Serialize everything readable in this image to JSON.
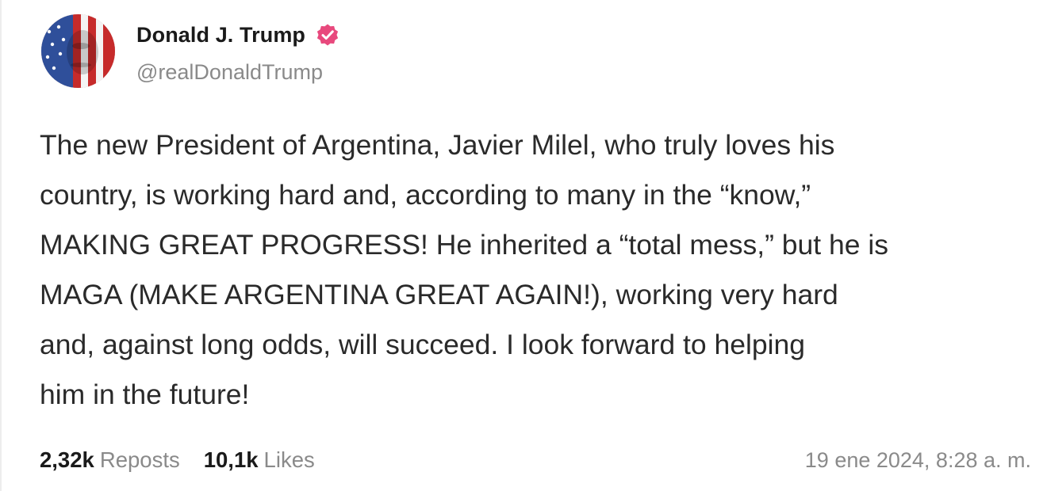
{
  "author": {
    "display_name": "Donald J. Trump",
    "handle": "@realDonaldTrump",
    "verified": true,
    "verified_badge_color": "#e8497d",
    "avatar_icon": "flag-portrait-avatar"
  },
  "post": {
    "text": "The new President of Argentina, Javier Milel, who truly loves his\ncountry, is working hard and, according to many in the “know,”\nMAKING GREAT PROGRESS! He inherited a “total mess,” but he is\nMAGA (MAKE ARGENTINA GREAT AGAIN!), working very hard\nand, against long odds, will succeed. I look forward to helping\nhim in the future!"
  },
  "stats": {
    "reposts_count": "2,32k",
    "reposts_label": "Reposts",
    "likes_count": "10,1k",
    "likes_label": "Likes"
  },
  "timestamp": "19 ene 2024, 8:28 a. m."
}
